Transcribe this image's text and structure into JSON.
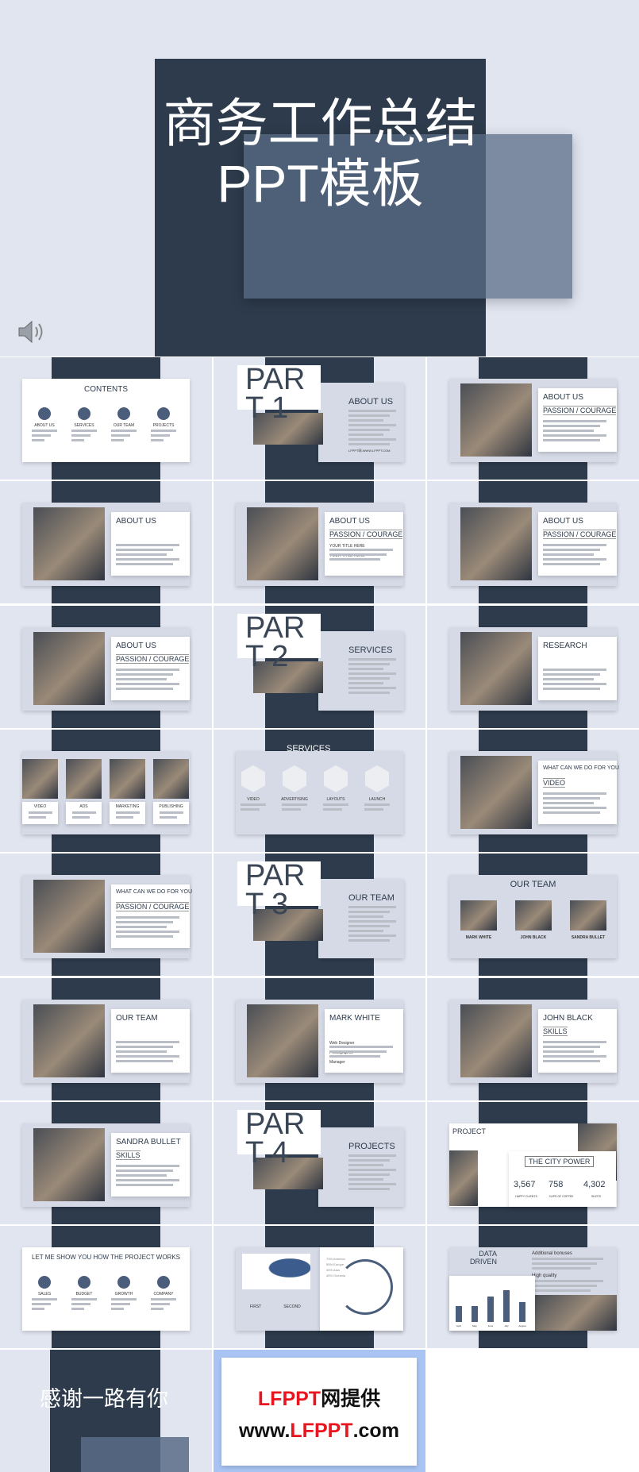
{
  "hero": {
    "title_line1": "商务工作总结",
    "title_line2": "PPT模板",
    "icon": "speaker-icon"
  },
  "colors": {
    "navy": "#2d3b4c",
    "background": "#e1e5f0",
    "panel": "#d6dae6",
    "brand_red": "#e8141e",
    "brand_border": "#a9c4f3"
  },
  "slides": [
    {
      "kind": "contents",
      "title": "CONTENTS",
      "items": [
        "ABOUT US",
        "SERVICES",
        "OUR TEAM",
        "PROJECTS"
      ]
    },
    {
      "kind": "part",
      "part": "PAR\nT 1",
      "title": "ABOUT US",
      "note": "LFPPT网-WWW.LFPPT.COM"
    },
    {
      "kind": "split",
      "title": "ABOUT US",
      "sub": "PASSION / COURAGE"
    },
    {
      "kind": "split",
      "title": "ABOUT US"
    },
    {
      "kind": "split",
      "title": "ABOUT US",
      "sub": "PASSION / COURAGE",
      "items": [
        "YOUR TITLE HERE",
        "YOUR TITLE HERE"
      ]
    },
    {
      "kind": "split",
      "title": "ABOUT US",
      "sub": "PASSION / COURAGE"
    },
    {
      "kind": "split",
      "title": "ABOUT US",
      "sub": "PASSION / COURAGE"
    },
    {
      "kind": "part",
      "part": "PAR\nT 2",
      "title": "SERVICES"
    },
    {
      "kind": "split",
      "title": "RESEARCH"
    },
    {
      "kind": "photos",
      "items": [
        "VIDEO",
        "ADS",
        "MARKETING",
        "PUBLISHING"
      ]
    },
    {
      "kind": "hexes",
      "title": "SERVICES",
      "items": [
        "VIDEO",
        "ADVERTISING",
        "LAYOUTS",
        "LAUNCH"
      ]
    },
    {
      "kind": "split",
      "title": "WHAT CAN WE DO FOR YOU",
      "sub": "VIDEO"
    },
    {
      "kind": "split",
      "title": "WHAT CAN WE DO FOR YOU",
      "sub": "PASSION / COURAGE"
    },
    {
      "kind": "part",
      "part": "PAR\nT 3",
      "title": "OUR TEAM"
    },
    {
      "kind": "team",
      "title": "OUR TEAM",
      "items": [
        "MARK WHITE",
        "JOHN BLACK",
        "SANDRA BULLET"
      ]
    },
    {
      "kind": "split",
      "title": "OUR TEAM"
    },
    {
      "kind": "split",
      "title": "MARK WHITE",
      "items": [
        "Web Designer",
        "Photographer",
        "Manager"
      ]
    },
    {
      "kind": "split",
      "title": "JOHN BLACK",
      "sub": "SKILLS"
    },
    {
      "kind": "split",
      "title": "SANDRA BULLET",
      "sub": "SKILLS"
    },
    {
      "kind": "part",
      "part": "PAR\nT 4",
      "title": "PROJECTS"
    },
    {
      "kind": "stats",
      "title": "PROJECT",
      "sub": "THE CITY POWER",
      "items": [
        "3,567",
        "758",
        "4,302"
      ],
      "labels": [
        "HAPPY CLIENTS",
        "CUPS OF COFFEE",
        "SHOTS"
      ]
    },
    {
      "kind": "contents",
      "title": "LET ME SHOW YOU HOW THE PROJECT WORKS",
      "items": [
        "SALES",
        "BUDGET",
        "GROWTH",
        "COMPANY"
      ]
    },
    {
      "kind": "map",
      "items": [
        "73% America",
        "55% Europe",
        "45% Asia",
        "45% Oceania"
      ],
      "labels": [
        "FIRST",
        "SECOND"
      ]
    },
    {
      "kind": "chart",
      "title": "DATA DRIVEN",
      "items": [
        "Additional bonuses",
        "High quality"
      ],
      "labels": [
        "April",
        "May",
        "June",
        "July",
        "August"
      ]
    },
    {
      "kind": "thanks",
      "title": "感谢一路有你"
    },
    {
      "kind": "brand",
      "title_red": "LFPPT",
      "title_black": "网提供",
      "url_pre": "www.",
      "url_red": "LFPPT",
      "url_post": ".com"
    }
  ]
}
